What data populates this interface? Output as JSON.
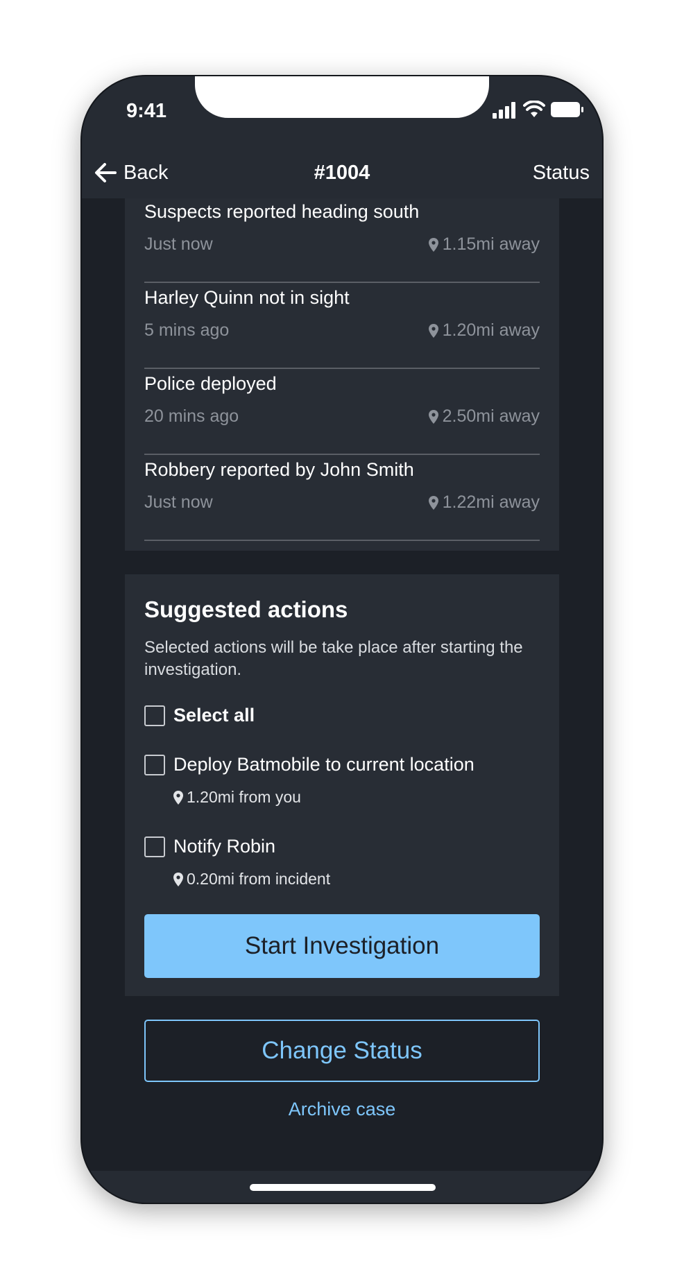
{
  "status_bar": {
    "time": "9:41"
  },
  "nav": {
    "back_label": "Back",
    "title": "#1004",
    "right_label": "Status"
  },
  "events": [
    {
      "title": "Suspects reported heading south",
      "time": "Just now",
      "distance": "1.15mi away"
    },
    {
      "title": "Harley Quinn not in sight",
      "time": "5 mins ago",
      "distance": "1.20mi away"
    },
    {
      "title": "Police deployed",
      "time": "20 mins ago",
      "distance": "2.50mi away"
    },
    {
      "title": "Robbery reported by John Smith",
      "time": "Just now",
      "distance": "1.22mi away"
    }
  ],
  "suggested": {
    "title": "Suggested actions",
    "description": "Selected actions will be take place after starting the investigation.",
    "select_all": "Select all",
    "items": [
      {
        "label": "Deploy Batmobile to current location",
        "info": "1.20mi from you"
      },
      {
        "label": "Notify Robin",
        "info": "0.20mi from incident"
      }
    ],
    "start_button": "Start Investigation"
  },
  "change_status_button": "Change Status",
  "archive_link": "Archive case",
  "colors": {
    "accent": "#7ec6fb",
    "background": "#1c2027",
    "card": "#282d35",
    "header": "#262b33"
  },
  "icons": [
    "back-arrow-icon",
    "signal-icon",
    "wifi-icon",
    "battery-icon",
    "location-pin-icon",
    "checkbox-icon"
  ]
}
